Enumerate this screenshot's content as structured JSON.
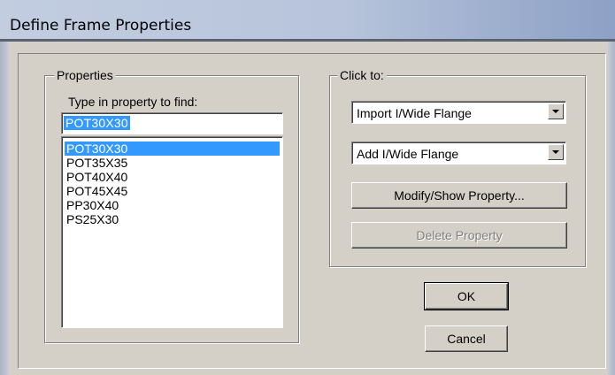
{
  "window": {
    "title": "Define Frame Properties"
  },
  "properties": {
    "legend": "Properties",
    "search_label": "Type in property to find:",
    "search_value": "POT30X30",
    "items": [
      "POT30X30",
      "POT35X35",
      "POT40X40",
      "POT45X45",
      "PP30X40",
      "PS25X30"
    ],
    "selected_item": "POT30X30"
  },
  "click_to": {
    "legend": "Click to:",
    "import_value": "Import I/Wide Flange",
    "add_value": "Add I/Wide Flange",
    "modify_label": "Modify/Show Property...",
    "delete_label": "Delete Property"
  },
  "buttons": {
    "ok_label": "OK",
    "cancel_label": "Cancel"
  },
  "colors": {
    "selection": "#3399ff",
    "face": "#d4d0c8"
  }
}
